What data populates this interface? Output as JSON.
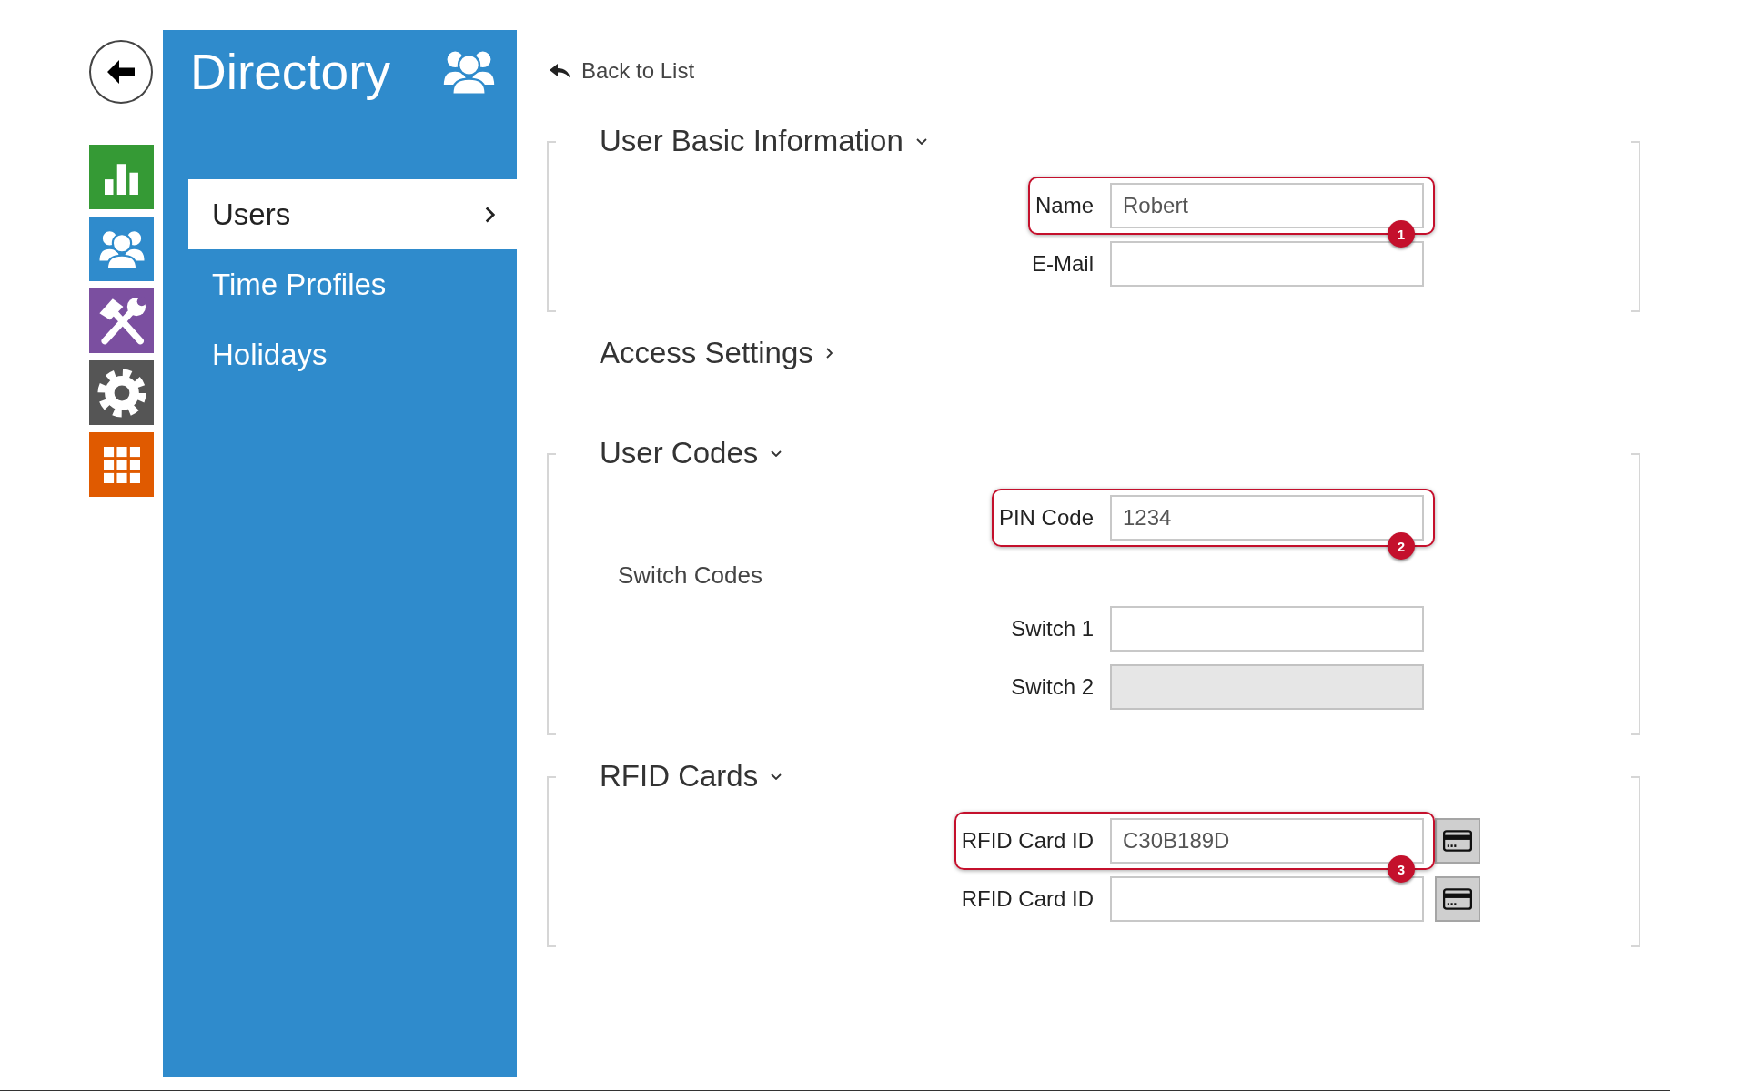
{
  "sidebar": {
    "title": "Directory",
    "items": [
      {
        "label": "Users",
        "selected": true
      },
      {
        "label": "Time Profiles",
        "selected": false
      },
      {
        "label": "Holidays",
        "selected": false
      }
    ]
  },
  "back_link": {
    "label": "Back to List"
  },
  "sections": [
    {
      "title": "User Basic Information",
      "expanded": true,
      "fields": [
        {
          "kind": "text",
          "label": "Name",
          "value": "Robert",
          "disabled": false,
          "callout": "1"
        },
        {
          "kind": "text",
          "label": "E-Mail",
          "disabled": false
        }
      ]
    },
    {
      "title": "Access Settings",
      "expanded": false
    },
    {
      "title": "User Codes",
      "expanded": true,
      "fields": [
        {
          "kind": "text",
          "label": "PIN Code",
          "value": "1234",
          "disabled": false,
          "callout": "2"
        }
      ],
      "groups": [
        {
          "title": "Switch Codes",
          "fields": [
            {
              "kind": "text",
              "label": "Switch 1",
              "disabled": false
            },
            {
              "kind": "text",
              "label": "Switch 2",
              "disabled": true
            }
          ]
        }
      ]
    },
    {
      "title": "RFID Cards",
      "expanded": true,
      "fields": [
        {
          "kind": "card",
          "label": "RFID Card ID",
          "value": "C30B189D",
          "disabled": false,
          "callout": "3"
        },
        {
          "kind": "card",
          "label": "RFID Card ID",
          "disabled": false
        }
      ]
    }
  ]
}
